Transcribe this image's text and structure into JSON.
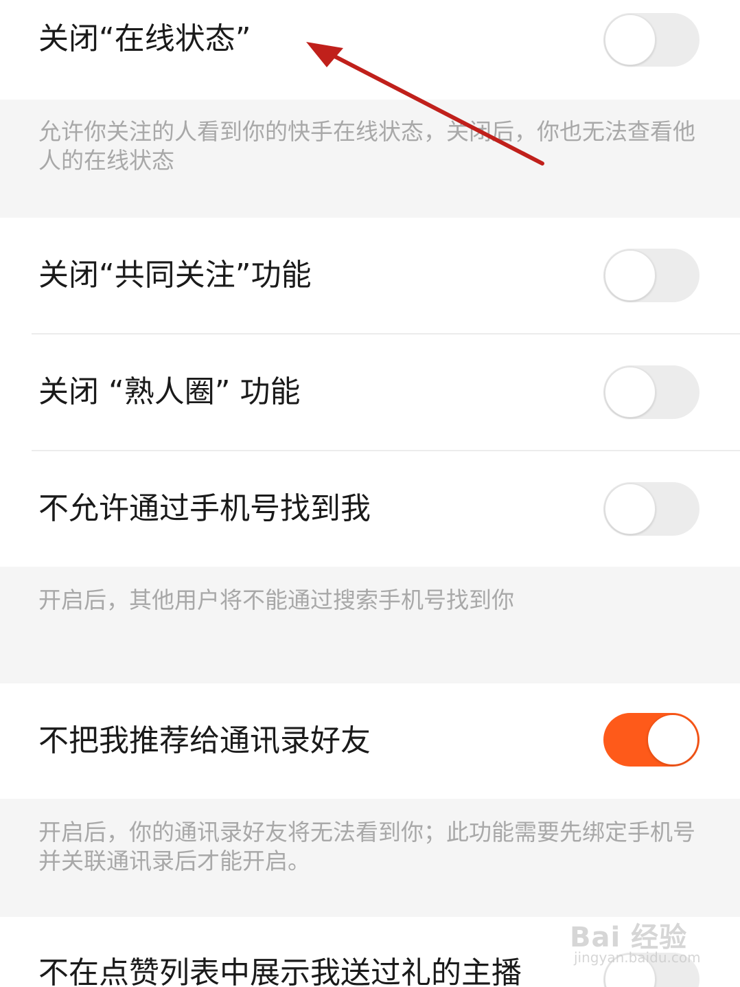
{
  "settings": [
    {
      "label": "关闭“在线状态”",
      "enabled": false,
      "description": "允许你关注的人看到你的快手在线状态，关闭后，你也无法查看他人的在线状态"
    },
    {
      "label": "关闭“共同关注”功能",
      "enabled": false
    },
    {
      "label": "关闭 “熟人圈” 功能",
      "enabled": false
    },
    {
      "label": "不允许通过手机号找到我",
      "enabled": false,
      "description": "开启后，其他用户将不能通过搜索手机号找到你"
    },
    {
      "label": "不把我推荐给通讯录好友",
      "enabled": true,
      "description": "开启后，你的通讯录好友将无法看到你；此功能需要先绑定手机号并关联通讯录后才能开启。"
    },
    {
      "label": "不在点赞列表中展示我送过礼的主播",
      "enabled": false
    }
  ],
  "colors": {
    "toggle_on": "#fe5a1a",
    "toggle_off": "#ececec",
    "annotation_arrow": "#c0201b"
  },
  "watermark": {
    "brand": "Bai 经验",
    "site": "jingyan.baidu.com"
  }
}
